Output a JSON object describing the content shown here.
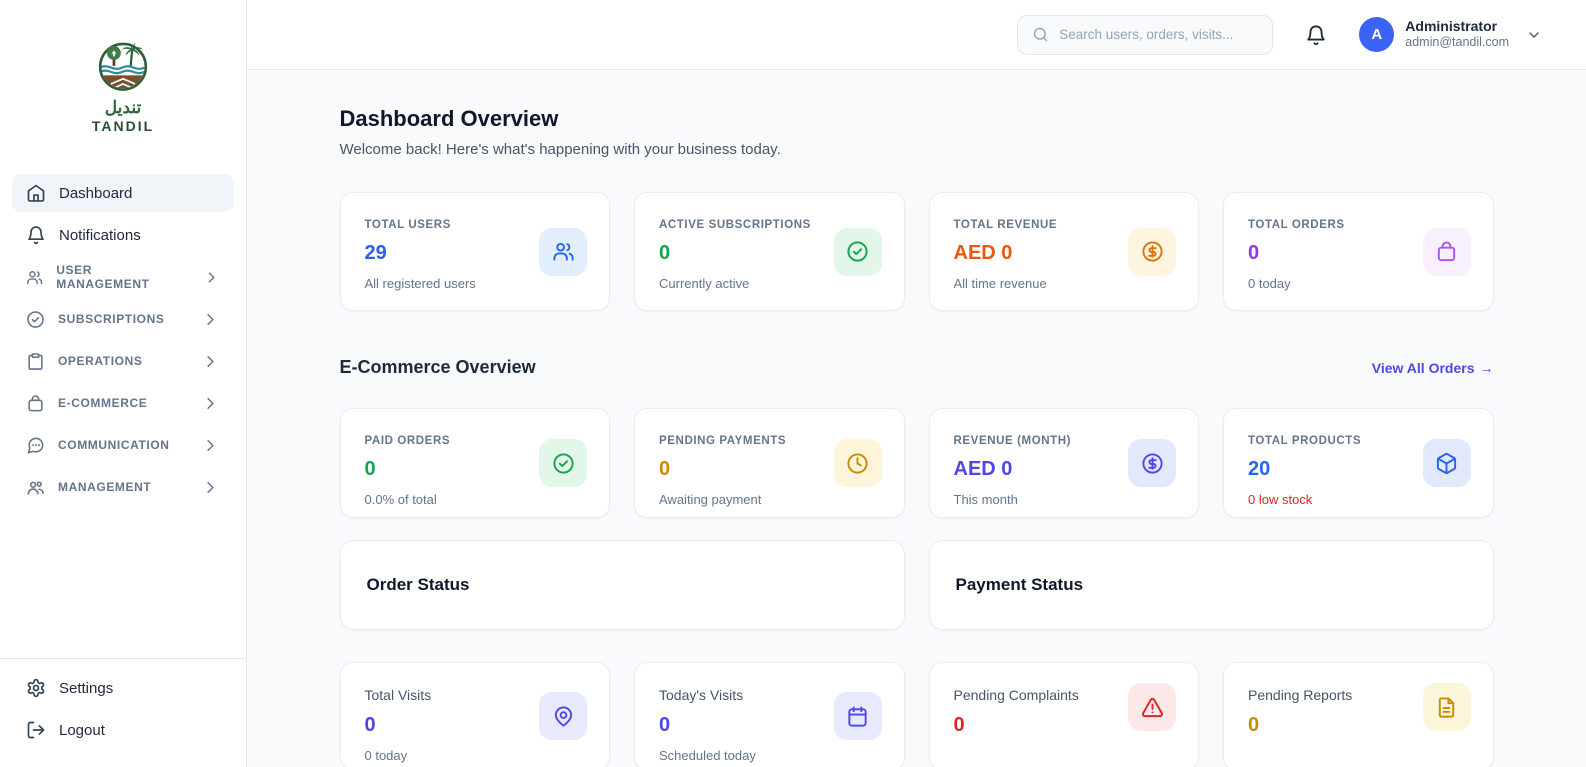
{
  "brand": {
    "logo_text_arabic": "تنديل",
    "logo_text": "TANDIL",
    "logo_icon": "tandil-palm-tree-logo",
    "logo_green": "#2f6b3a"
  },
  "header": {
    "search": {
      "placeholder": "Search users, orders, visits...",
      "icon": "search-icon"
    },
    "notifications_icon": "bell-icon",
    "user": {
      "name": "Administrator",
      "email": "admin@tandil.com",
      "avatar_initial": "A",
      "avatar_color": "#3b63f6",
      "menu_icon": "chevron-down-icon"
    }
  },
  "sidebar": {
    "items": [
      {
        "label": "Dashboard",
        "icon": "home-icon",
        "active": true
      },
      {
        "label": "Notifications",
        "icon": "bell-icon",
        "active": false
      },
      {
        "label": "USER MANAGEMENT",
        "icon": "users-icon",
        "expandable": true
      },
      {
        "label": "SUBSCRIPTIONS",
        "icon": "check-circle-icon",
        "expandable": true
      },
      {
        "label": "OPERATIONS",
        "icon": "clipboard-icon",
        "expandable": true
      },
      {
        "label": "E-COMMERCE",
        "icon": "shopping-bag-icon",
        "expandable": true
      },
      {
        "label": "COMMUNICATION",
        "icon": "chat-bubble-icon",
        "expandable": true
      },
      {
        "label": "MANAGEMENT",
        "icon": "team-icon",
        "expandable": true
      }
    ],
    "footer": [
      {
        "label": "Settings",
        "icon": "gear-icon"
      },
      {
        "label": "Logout",
        "icon": "logout-icon"
      }
    ]
  },
  "overview": {
    "title": "Dashboard Overview",
    "subtitle": "Welcome back! Here's what's happening with your business today.",
    "cards": [
      {
        "label": "TOTAL USERS",
        "value": "29",
        "subtext": "All registered users",
        "icon": "users-icon",
        "value_color": "#2563eb",
        "icon_color": "#2563eb",
        "icon_bg": "#e3eefc",
        "subtext_color": "#64748b"
      },
      {
        "label": "ACTIVE SUBSCRIPTIONS",
        "value": "0",
        "subtext": "Currently active",
        "icon": "check-circle-icon",
        "value_color": "#16a34a",
        "icon_color": "#16a34a",
        "icon_bg": "#e2f6e9",
        "subtext_color": "#64748b"
      },
      {
        "label": "TOTAL REVENUE",
        "value": "AED 0",
        "subtext": "All time revenue",
        "icon": "dollar-circle-icon",
        "value_color": "#ea580c",
        "icon_color": "#d97706",
        "icon_bg": "#fdf5e0",
        "subtext_color": "#64748b"
      },
      {
        "label": "TOTAL ORDERS",
        "value": "0",
        "subtext": "0 today",
        "icon": "shopping-bag-icon",
        "value_color": "#9333ea",
        "icon_color": "#a855f7",
        "icon_bg": "#f8f0fe",
        "subtext_color": "#64748b"
      }
    ]
  },
  "ecommerce": {
    "title": "E-Commerce Overview",
    "link_label": "View All Orders",
    "link_arrow": "→",
    "link_color": "#4f46e5",
    "cards": [
      {
        "label": "PAID ORDERS",
        "value": "0",
        "subtext": "0.0% of total",
        "icon": "check-circle-icon",
        "value_color": "#16a34a",
        "icon_color": "#16a34a",
        "icon_bg": "#e2f6e9",
        "subtext_color": "#64748b"
      },
      {
        "label": "PENDING PAYMENTS",
        "value": "0",
        "subtext": "Awaiting payment",
        "icon": "clock-icon",
        "value_color": "#ca8a04",
        "icon_color": "#ca8a04",
        "icon_bg": "#fdf4d9",
        "subtext_color": "#64748b"
      },
      {
        "label": "REVENUE (MONTH)",
        "value": "AED 0",
        "subtext": "This month",
        "icon": "dollar-circle-icon",
        "value_color": "#4f46e5",
        "icon_color": "#4f46e5",
        "icon_bg": "#e4e8fc",
        "subtext_color": "#64748b"
      },
      {
        "label": "TOTAL PRODUCTS",
        "value": "20",
        "subtext": "0 low stock",
        "icon": "package-icon",
        "value_color": "#2563eb",
        "icon_color": "#2563eb",
        "icon_bg": "#e2e9fc",
        "subtext_color": "#dc2626"
      }
    ]
  },
  "status_panels": [
    {
      "title": "Order Status"
    },
    {
      "title": "Payment Status"
    }
  ],
  "visits": {
    "cards": [
      {
        "label": "Total Visits",
        "value": "0",
        "subtext": "0 today",
        "icon": "map-pin-icon",
        "value_color": "#4f46e5",
        "icon_color": "#4f46e5",
        "icon_bg": "#e7e9fc",
        "subtext_color": "#64748b"
      },
      {
        "label": "Today's Visits",
        "value": "0",
        "subtext": "Scheduled today",
        "icon": "calendar-icon",
        "value_color": "#4f46e5",
        "icon_color": "#4f46e5",
        "icon_bg": "#e7e9fc",
        "subtext_color": "#64748b"
      },
      {
        "label": "Pending Complaints",
        "value": "0",
        "subtext": "",
        "icon": "alert-triangle-icon",
        "value_color": "#dc2626",
        "icon_color": "#dc2626",
        "icon_bg": "#fce8e8",
        "subtext_color": "#64748b"
      },
      {
        "label": "Pending Reports",
        "value": "0",
        "subtext": "",
        "icon": "file-text-icon",
        "value_color": "#ca8a04",
        "icon_color": "#ca8a04",
        "icon_bg": "#fbf6d9",
        "subtext_color": "#64748b"
      }
    ]
  }
}
